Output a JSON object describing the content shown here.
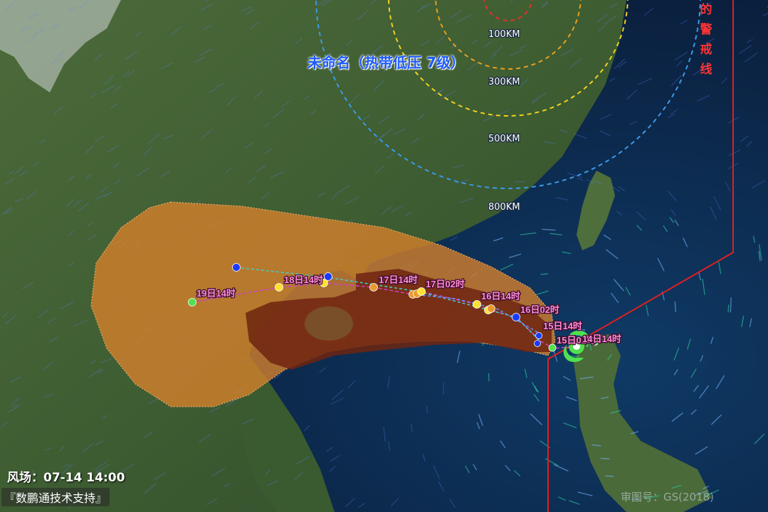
{
  "storm": {
    "title": "未命名（热带低压 7级）"
  },
  "warning_line": {
    "label_chars": [
      "的",
      "警",
      "戒",
      "线"
    ]
  },
  "radius_rings": {
    "labels": [
      "100KM",
      "300KM",
      "500KM",
      "800KM"
    ]
  },
  "track_labels": [
    {
      "text": "19日14时"
    },
    {
      "text": "18日14时"
    },
    {
      "text": "17日14时"
    },
    {
      "text": "17日02时"
    },
    {
      "text": "16日14时"
    },
    {
      "text": "16日02时"
    },
    {
      "text": "15日14时"
    },
    {
      "text": "15日02时"
    },
    {
      "text": "14日14时"
    }
  ],
  "footer": {
    "wind_field_time": "风场：07-14 14:00",
    "support": "『数鹏通技术支持』",
    "map_credit": "审图号：GS(2018)"
  },
  "colors": {
    "cone_outer": "#d9822b",
    "cone_inner": "#7a2a14",
    "track_line": "#d040d0",
    "ring_100": "#e03030",
    "ring_300": "#e8a020",
    "ring_500": "#f0d020",
    "ring_800": "#3a9ae8",
    "warning_line": "#e02020",
    "forecast_yellow": "#ffe030",
    "forecast_orange": "#e89a30",
    "forecast_blue": "#1a3aff",
    "forecast_green": "#50e050"
  },
  "icons": [
    "typhoon-center-icon"
  ]
}
